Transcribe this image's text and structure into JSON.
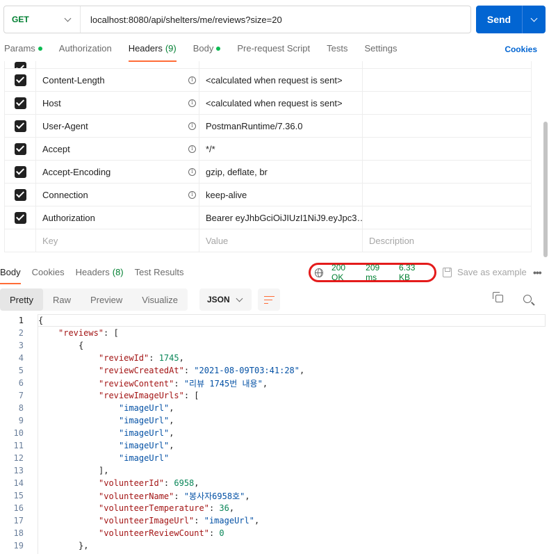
{
  "request": {
    "method": "GET",
    "url": "localhost:8080/api/shelters/me/reviews?size=20",
    "send_label": "Send"
  },
  "request_tabs": [
    {
      "label": "Params",
      "dot": true
    },
    {
      "label": "Authorization"
    },
    {
      "label": "Headers",
      "count": "(9)",
      "active": true
    },
    {
      "label": "Body",
      "dot": true
    },
    {
      "label": "Pre-request Script"
    },
    {
      "label": "Tests"
    },
    {
      "label": "Settings"
    }
  ],
  "cookies_label": "Cookies",
  "headers": [
    {
      "key": "Content-Length",
      "value": "<calculated when request is sent>",
      "info": true
    },
    {
      "key": "Host",
      "value": "<calculated when request is sent>",
      "info": true
    },
    {
      "key": "User-Agent",
      "value": "PostmanRuntime/7.36.0",
      "info": true
    },
    {
      "key": "Accept",
      "value": "*/*",
      "info": true
    },
    {
      "key": "Accept-Encoding",
      "value": "gzip, deflate, br",
      "info": true
    },
    {
      "key": "Connection",
      "value": "keep-alive",
      "info": true
    },
    {
      "key": "Authorization",
      "value": "Bearer eyJhbGciOiJIUzI1NiJ9.eyJpc3…",
      "info": false
    }
  ],
  "headers_placeholder": {
    "key": "Key",
    "value": "Value",
    "description": "Description"
  },
  "response_tabs": [
    {
      "label": "Body",
      "active": true
    },
    {
      "label": "Cookies"
    },
    {
      "label": "Headers",
      "count": "(8)"
    },
    {
      "label": "Test Results"
    }
  ],
  "status": {
    "code": "200 OK",
    "time": "209 ms",
    "size": "6.33 KB"
  },
  "save_example_label": "Save as example",
  "more_label": "•••",
  "view_modes": [
    "Pretty",
    "Raw",
    "Preview",
    "Visualize"
  ],
  "format": "JSON",
  "colors": {
    "accent": "#ff6c37",
    "send": "#0265d2",
    "status_ok": "#007f31",
    "highlight_ring": "#e41b1b"
  },
  "code_lines": [
    {
      "n": "1",
      "indent": 0,
      "parts": [
        [
          "p",
          "{"
        ]
      ]
    },
    {
      "n": "2",
      "indent": 1,
      "parts": [
        [
          "k",
          "\"reviews\""
        ],
        [
          "p",
          ": ["
        ]
      ]
    },
    {
      "n": "3",
      "indent": 2,
      "parts": [
        [
          "p",
          "{"
        ]
      ]
    },
    {
      "n": "4",
      "indent": 3,
      "parts": [
        [
          "k",
          "\"reviewId\""
        ],
        [
          "p",
          ": "
        ],
        [
          "n",
          "1745"
        ],
        [
          "p",
          ","
        ]
      ]
    },
    {
      "n": "5",
      "indent": 3,
      "parts": [
        [
          "k",
          "\"reviewCreatedAt\""
        ],
        [
          "p",
          ": "
        ],
        [
          "s",
          "\"2021-08-09T03:41:28\""
        ],
        [
          "p",
          ","
        ]
      ]
    },
    {
      "n": "6",
      "indent": 3,
      "parts": [
        [
          "k",
          "\"reviewContent\""
        ],
        [
          "p",
          ": "
        ],
        [
          "s",
          "\"리뷰 1745번 내용\""
        ],
        [
          "p",
          ","
        ]
      ]
    },
    {
      "n": "7",
      "indent": 3,
      "parts": [
        [
          "k",
          "\"reviewImageUrls\""
        ],
        [
          "p",
          ": ["
        ]
      ]
    },
    {
      "n": "8",
      "indent": 4,
      "parts": [
        [
          "s",
          "\"imageUrl\""
        ],
        [
          "p",
          ","
        ]
      ]
    },
    {
      "n": "9",
      "indent": 4,
      "parts": [
        [
          "s",
          "\"imageUrl\""
        ],
        [
          "p",
          ","
        ]
      ]
    },
    {
      "n": "10",
      "indent": 4,
      "parts": [
        [
          "s",
          "\"imageUrl\""
        ],
        [
          "p",
          ","
        ]
      ]
    },
    {
      "n": "11",
      "indent": 4,
      "parts": [
        [
          "s",
          "\"imageUrl\""
        ],
        [
          "p",
          ","
        ]
      ]
    },
    {
      "n": "12",
      "indent": 4,
      "parts": [
        [
          "s",
          "\"imageUrl\""
        ]
      ]
    },
    {
      "n": "13",
      "indent": 3,
      "parts": [
        [
          "p",
          "],"
        ]
      ]
    },
    {
      "n": "14",
      "indent": 3,
      "parts": [
        [
          "k",
          "\"volunteerId\""
        ],
        [
          "p",
          ": "
        ],
        [
          "n",
          "6958"
        ],
        [
          "p",
          ","
        ]
      ]
    },
    {
      "n": "15",
      "indent": 3,
      "parts": [
        [
          "k",
          "\"volunteerName\""
        ],
        [
          "p",
          ": "
        ],
        [
          "s",
          "\"봉사자6958호\""
        ],
        [
          "p",
          ","
        ]
      ]
    },
    {
      "n": "16",
      "indent": 3,
      "parts": [
        [
          "k",
          "\"volunteerTemperature\""
        ],
        [
          "p",
          ": "
        ],
        [
          "n",
          "36"
        ],
        [
          "p",
          ","
        ]
      ]
    },
    {
      "n": "17",
      "indent": 3,
      "parts": [
        [
          "k",
          "\"volunteerImageUrl\""
        ],
        [
          "p",
          ": "
        ],
        [
          "s",
          "\"imageUrl\""
        ],
        [
          "p",
          ","
        ]
      ]
    },
    {
      "n": "18",
      "indent": 3,
      "parts": [
        [
          "k",
          "\"volunteerReviewCount\""
        ],
        [
          "p",
          ": "
        ],
        [
          "n",
          "0"
        ]
      ]
    },
    {
      "n": "19",
      "indent": 2,
      "parts": [
        [
          "p",
          "},"
        ]
      ]
    }
  ]
}
